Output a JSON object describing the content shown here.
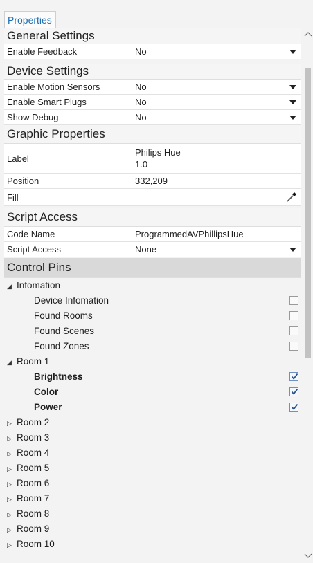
{
  "tab": {
    "label": "Properties"
  },
  "general": {
    "title": "General Settings",
    "enable_feedback": {
      "label": "Enable Feedback",
      "value": "No"
    }
  },
  "device": {
    "title": "Device Settings",
    "rows": [
      {
        "label": "Enable Motion Sensors",
        "value": "No"
      },
      {
        "label": "Enable Smart Plugs",
        "value": "No"
      },
      {
        "label": "Show Debug",
        "value": "No"
      }
    ]
  },
  "graphic": {
    "title": "Graphic Properties",
    "label": {
      "label": "Label",
      "line1": "Philips Hue",
      "line2": "1.0"
    },
    "position": {
      "label": "Position",
      "value": "332,209"
    },
    "fill": {
      "label": "Fill",
      "value": ""
    }
  },
  "script": {
    "title": "Script Access",
    "code_name": {
      "label": "Code Name",
      "value": "ProgrammedAVPhillipsHue"
    },
    "script_access": {
      "label": "Script Access",
      "value": "None"
    }
  },
  "pins": {
    "title": "Control Pins",
    "infomation": {
      "label": "Infomation",
      "items": [
        "Device Infomation",
        "Found Rooms",
        "Found Scenes",
        "Found Zones"
      ]
    },
    "room1": {
      "label": "Room 1",
      "items": [
        "Brightness",
        "Color",
        "Power"
      ]
    },
    "rooms": [
      "Room 2",
      "Room 3",
      "Room 4",
      "Room 5",
      "Room 6",
      "Room 7",
      "Room 8",
      "Room 9",
      "Room 10"
    ]
  },
  "colors": {
    "accent": "#1c6fb4",
    "section_dark": "#d9d9d9",
    "check": "#2a4f8a"
  },
  "icons": {
    "expanded": "triangle-down-icon",
    "collapsed": "triangle-right-icon",
    "dropper": "eyedropper-icon"
  }
}
